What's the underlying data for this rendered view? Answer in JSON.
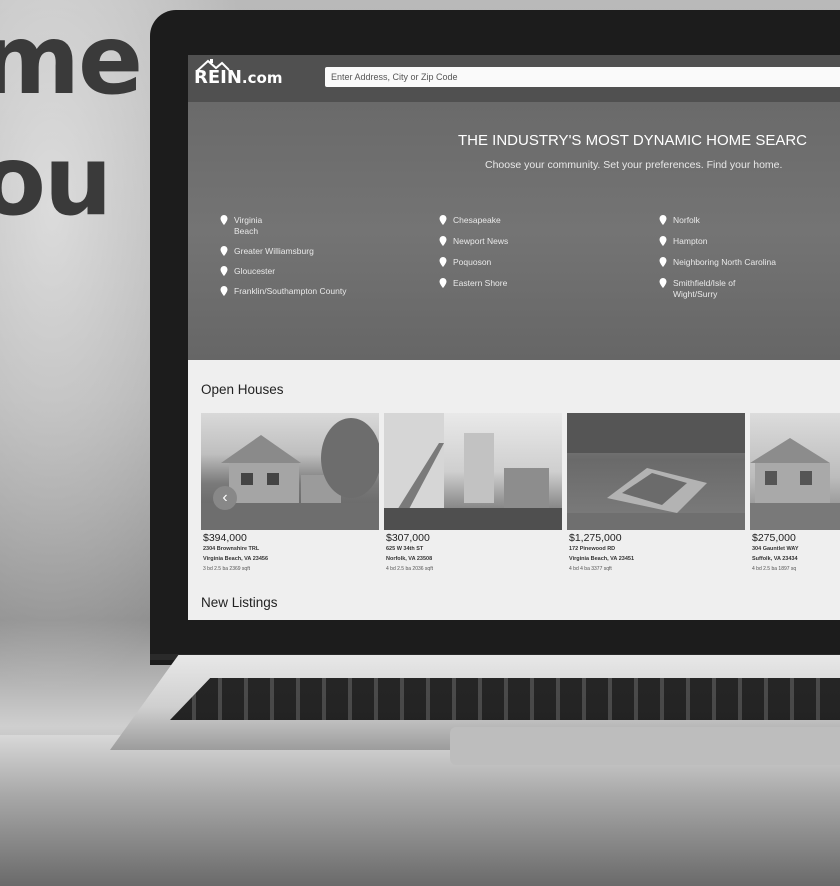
{
  "headline": {
    "line1": "me",
    "line2": "ou"
  },
  "site": {
    "logo_text": "REIN",
    "logo_suffix": ".com",
    "search_placeholder": "Enter Address, City or Zip Code",
    "hero_title": "THE INDUSTRY'S MOST DYNAMIC HOME SEARC",
    "hero_subtitle": "Choose your community. Set your preferences. Find your home.",
    "communities": [
      [
        "Virginia",
        "Beach"
      ],
      [
        "Greater Williamsburg"
      ],
      [
        "Gloucester"
      ],
      [
        "Franklin/Southampton County"
      ],
      [
        "Chesapeake"
      ],
      [
        "Newport News"
      ],
      [
        "Poquoson"
      ],
      [
        "Eastern Shore"
      ],
      [
        "Norfolk"
      ],
      [
        "Hampton"
      ],
      [
        "Neighboring North Carolina"
      ],
      [
        "Smithfield/Isle of",
        "Wight/Surry"
      ]
    ],
    "open_houses_title": "Open Houses",
    "new_listings_title": "New Listings",
    "listings": [
      {
        "price": "$394,000",
        "address": "2304 Brownshire TRL",
        "city": "Virginia Beach, VA 23456",
        "meta": "3 bd   2.5 ba   2369 sqft"
      },
      {
        "price": "$307,000",
        "address": "625 W 34th ST",
        "city": "Norfolk, VA 23508",
        "meta": "4 bd   2.5 ba   2036 sqft"
      },
      {
        "price": "$1,275,000",
        "address": "172 Pinewood RD",
        "city": "Virginia Beach, VA 23451",
        "meta": "4 bd   4 ba   3377 sqft"
      },
      {
        "price": "$275,000",
        "address": "304 Gauntlet WAY",
        "city": "Suffolk, VA 23434",
        "meta": "4 bd   2.5 ba   1897 sq"
      }
    ],
    "carousel_prev": "‹"
  }
}
